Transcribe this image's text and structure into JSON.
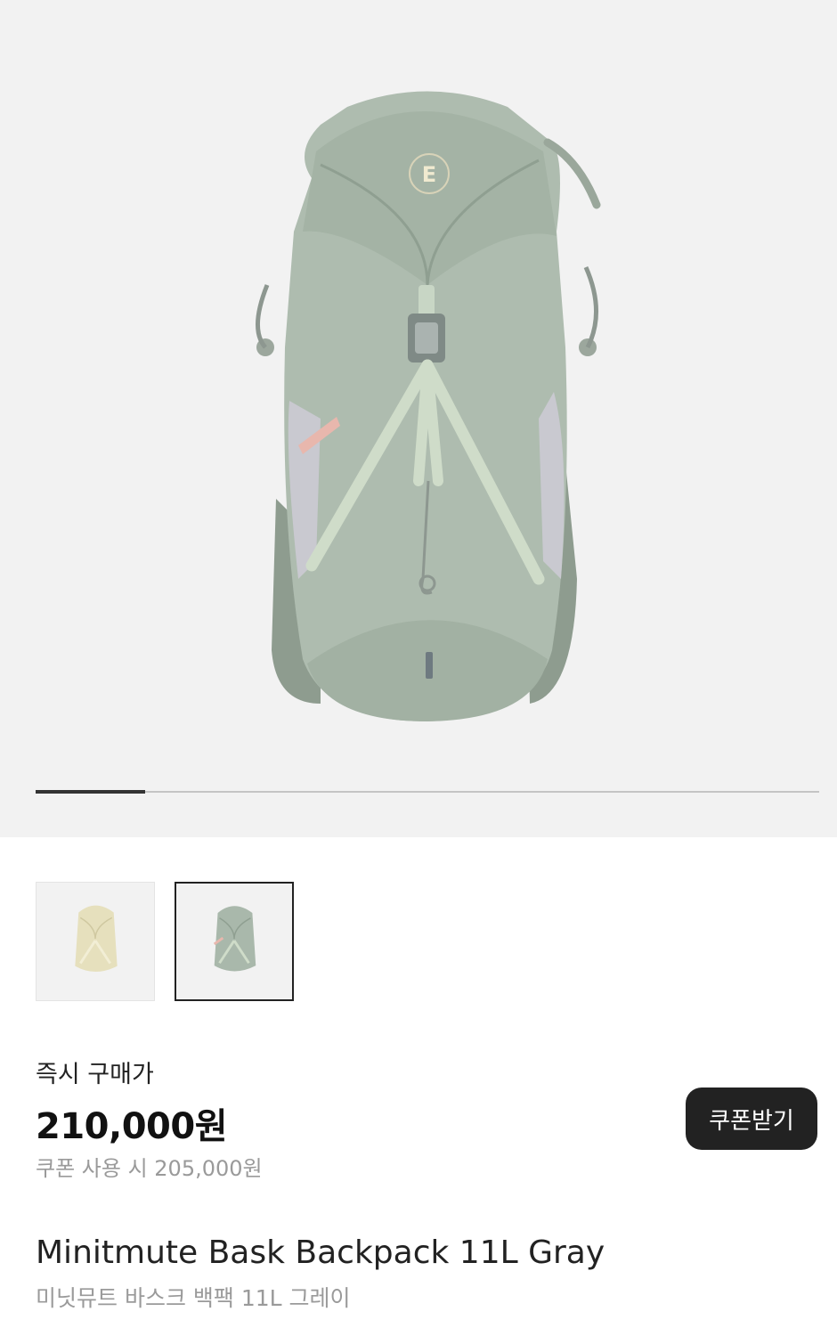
{
  "gallery": {
    "main_image": "backpack-gray-front",
    "progress": 0.14,
    "thumbnails": [
      {
        "name": "backpack-beige",
        "color": "#e6e0bd",
        "selected": false
      },
      {
        "name": "backpack-gray",
        "color": "#a9b8ab",
        "selected": true
      }
    ]
  },
  "pricing": {
    "label": "즉시 구매가",
    "price": "210,000원",
    "coupon_price": "쿠폰 사용 시 205,000원",
    "coupon_button": "쿠폰받기"
  },
  "product": {
    "title_en": "Minitmute Bask Backpack 11L Gray",
    "title_ko": "미닛뮤트 바스크 백팩 11L 그레이"
  },
  "colors": {
    "hero_bg": "#f2f2f2",
    "bag_main": "#aebcaf",
    "accent_dark": "#222222",
    "muted_text": "#9a9a9a"
  }
}
